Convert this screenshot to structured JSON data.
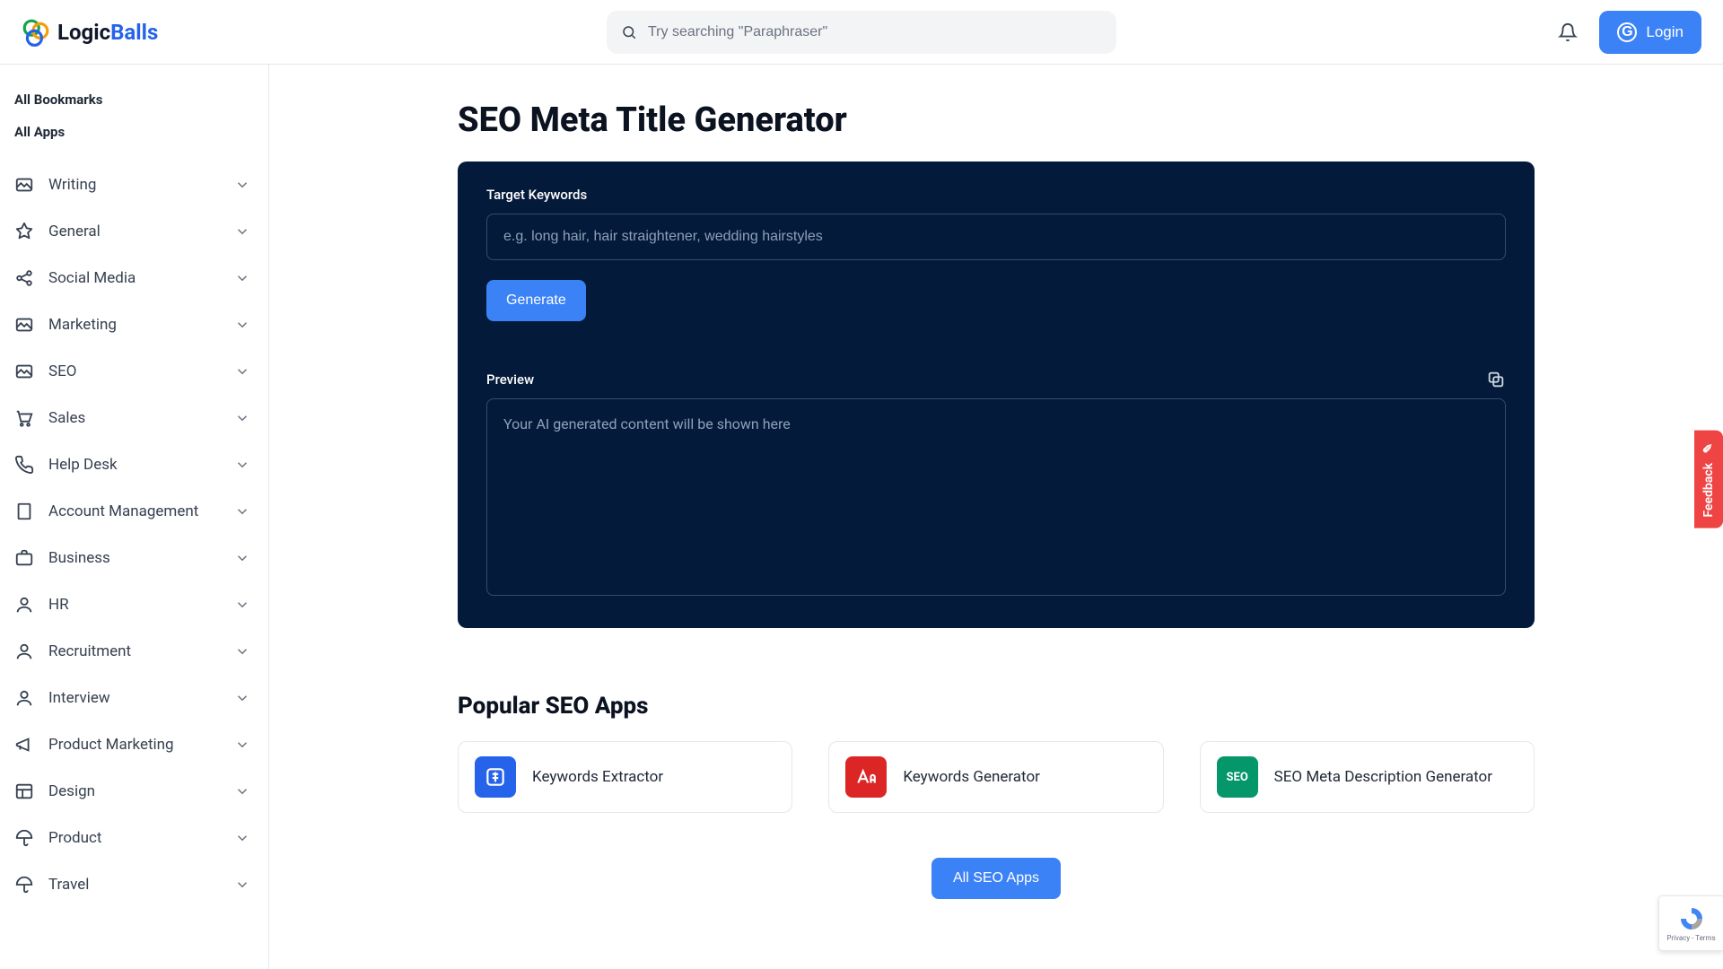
{
  "header": {
    "brand_first": "Logic",
    "brand_second": "Balls",
    "search_placeholder": "Try searching \"Paraphraser\"",
    "login_label": "Login"
  },
  "sidebar": {
    "all_bookmarks": "All Bookmarks",
    "all_apps": "All Apps",
    "categories": [
      {
        "label": "Writing",
        "icon": "image"
      },
      {
        "label": "General",
        "icon": "pin"
      },
      {
        "label": "Social Media",
        "icon": "share"
      },
      {
        "label": "Marketing",
        "icon": "image"
      },
      {
        "label": "SEO",
        "icon": "image"
      },
      {
        "label": "Sales",
        "icon": "cart"
      },
      {
        "label": "Help Desk",
        "icon": "phone"
      },
      {
        "label": "Account Management",
        "icon": "building"
      },
      {
        "label": "Business",
        "icon": "briefcase"
      },
      {
        "label": "HR",
        "icon": "user"
      },
      {
        "label": "Recruitment",
        "icon": "user"
      },
      {
        "label": "Interview",
        "icon": "user"
      },
      {
        "label": "Product Marketing",
        "icon": "megaphone"
      },
      {
        "label": "Design",
        "icon": "layout"
      },
      {
        "label": "Product",
        "icon": "umbrella"
      },
      {
        "label": "Travel",
        "icon": "umbrella"
      }
    ]
  },
  "main": {
    "title": "SEO Meta Title Generator",
    "keywords_label": "Target Keywords",
    "keywords_placeholder": "e.g. long hair, hair straightener, wedding hairstyles",
    "generate_label": "Generate",
    "preview_label": "Preview",
    "preview_placeholder": "Your AI generated content will be shown here",
    "popular_title": "Popular SEO Apps",
    "popular_apps": [
      {
        "title": "Keywords Extractor",
        "icon_color": "blue",
        "icon": "extract"
      },
      {
        "title": "Keywords Generator",
        "icon_color": "red",
        "icon": "aa"
      },
      {
        "title": "SEO Meta Description Generator",
        "icon_color": "green",
        "icon_text": "SEO"
      }
    ],
    "all_apps_label": "All SEO Apps"
  },
  "feedback": {
    "label": "Feedback"
  },
  "recaptcha": {
    "line1": "reCAPTCHA",
    "line2": "Privacy - Terms"
  }
}
